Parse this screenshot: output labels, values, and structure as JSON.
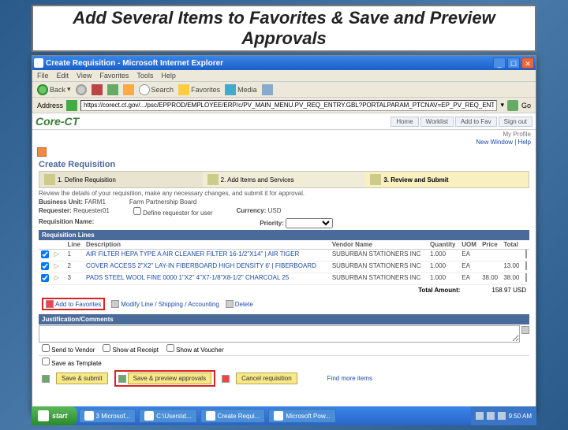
{
  "slide_title": "Add Several Items to Favorites & Save and Preview Approvals",
  "ie": {
    "title": "Create Requisition - Microsoft Internet Explorer",
    "menu": [
      "File",
      "Edit",
      "View",
      "Favorites",
      "Tools",
      "Help"
    ],
    "toolbar": {
      "back": "Back",
      "search": "Search",
      "favorites": "Favorites",
      "media": "Media"
    },
    "address_label": "Address",
    "address": "https://corect.ct.gov/.../psc/EPPROD/EMPLOYEE/ERP/c/PV_MAIN_MENU.PV_REQ_ENTRY.GBL?PORTALPARAM_PTCNAV=EP_PV_REQ_ENTRY",
    "go": "Go"
  },
  "core": {
    "logo": "Core-CT",
    "nav": [
      "Home",
      "Worklist",
      "Add to Fav",
      "Sign out"
    ],
    "user": "My Profile",
    "links": "New Window | Help"
  },
  "page": {
    "title": "Create Requisition",
    "wizard": [
      "1. Define Requisition",
      "2. Add Items and Services",
      "3. Review and Submit"
    ],
    "instruction": "Review the details of your requisition, make any necessary changes, and submit it for approval.",
    "business_unit_label": "Business Unit:",
    "business_unit": "FARM1",
    "business_unit_desc": "Farm Partnership Board",
    "requester_label": "Requester:",
    "requester": "Requester01",
    "entered_label": "",
    "currency_label": "Currency:",
    "currency": "USD",
    "req_name_label": "Requisition Name:",
    "priority_label": "Priority:",
    "lines_header": "Requisition Lines",
    "columns": {
      "line": "Line",
      "desc": "Description",
      "vendor": "Vendor Name",
      "qty": "Quantity",
      "uom": "UOM",
      "price": "Price",
      "total": "Total"
    },
    "lines": [
      {
        "line": "1",
        "desc": "AIR FILTER HEPA TYPE A AIR CLEANER\nFILTER 16-1/2\"X14\" | AIR TIGER",
        "vendor": "SUBURBAN STATIONERS INC",
        "qty": "1.000",
        "uom": "EA",
        "price": "",
        "total": ""
      },
      {
        "line": "2",
        "desc": "COVER ACCESS 2\"X2\" LAY-IN\nFIBERBOARD HIGH DENSITY 6' | FIBERBOARD",
        "vendor": "SUBURBAN STATIONERS INC",
        "qty": "1.000",
        "uom": "EA",
        "price": "",
        "total": "13.00"
      },
      {
        "line": "3",
        "desc": "PADS STEEL WOOL FINE 0000 1\"X2\"\n4\"X7-1/8\"X8-1/2\" CHARCOAL 25",
        "vendor": "SUBURBAN STATIONERS INC",
        "qty": "1.000",
        "uom": "EA",
        "price": "38.00",
        "total": "38.00"
      }
    ],
    "action_links": {
      "add_fav": "Add to Favorites",
      "modify": "Modify Line / Shipping / Accounting",
      "delete": "Delete"
    },
    "total_label": "Total Amount:",
    "total_value": "158.97 USD",
    "justification_header": "Justification/Comments",
    "send_vendor": "Send to Vendor",
    "show_receipt": "Show at Receipt",
    "show_voucher": "Show at Voucher",
    "save_template": "Save as Template",
    "buttons": {
      "save_submit": "Save & submit",
      "save_preview": "Save & preview approvals",
      "cancel": "Cancel requisition",
      "find_more": "Find more items"
    }
  },
  "taskbar": {
    "start": "start",
    "items": [
      "3 Microsof...",
      "C:\\Users\\d...",
      "Create Requi...",
      "Microsoft Pow..."
    ],
    "time": "9:50 AM"
  }
}
